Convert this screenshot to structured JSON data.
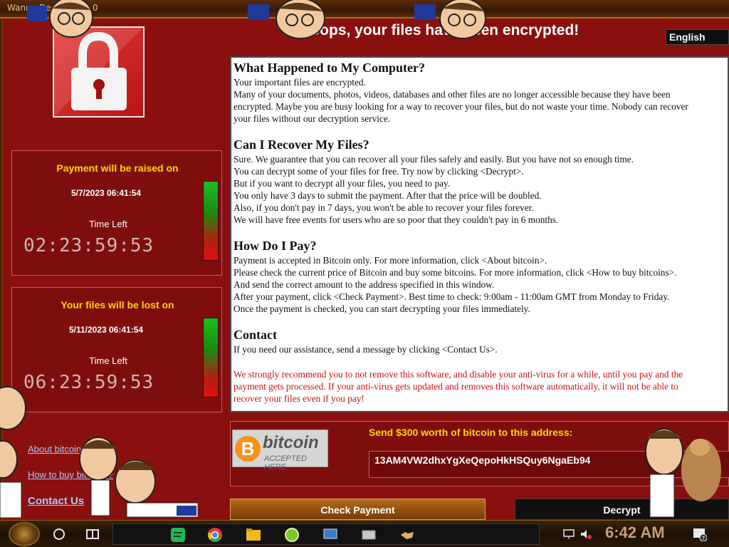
{
  "window": {
    "title": "Wanna Decryptor 2.0",
    "headline": "Ooops, your files have been encrypted!",
    "language": "English"
  },
  "timers": {
    "raise": {
      "heading": "Payment will be raised on",
      "date": "5/7/2023 06:41:54",
      "time_left_label": "Time Left",
      "countdown": "02:23:59:53"
    },
    "lost": {
      "heading": "Your files will be lost on",
      "date": "5/11/2023 06:41:54",
      "time_left_label": "Time Left",
      "countdown": "06:23:59:53"
    }
  },
  "links": {
    "about": "About bitcoin",
    "howto": "How to buy bitcoins?",
    "contact": "Contact Us"
  },
  "content": {
    "h1": "What Happened to My Computer?",
    "p1a": "Your important files are encrypted.",
    "p1b": "Many of your documents, photos, videos, databases and other files are no longer accessible because they have been",
    "p1c": "encrypted. Maybe you are busy looking for a way to recover your files, but do not waste your time. Nobody can recover",
    "p1d": "your files without our decryption service.",
    "h2": "Can I Recover My Files?",
    "p2a": "Sure. We guarantee that you can recover all your files safely and easily. But you have not so enough time.",
    "p2b": "You can decrypt some of your files for free. Try now by clicking <Decrypt>.",
    "p2c": "But if you want to decrypt all your files, you need to pay.",
    "p2d": "You only have 3 days to submit the payment. After that the price will be doubled.",
    "p2e": "Also, if you don't pay in 7 days, you won't be able to recover your files forever.",
    "p2f": "We will have free events for users who are so poor that they couldn't pay in 6 months.",
    "h3": "How Do I Pay?",
    "p3a": "Payment is accepted in Bitcoin only. For more information, click <About bitcoin>.",
    "p3b": "Please check the current price of Bitcoin and buy some bitcoins. For more information, click <How to buy bitcoins>.",
    "p3c": "And send the correct amount to the address specified in this window.",
    "p3d": "After your payment, click <Check Payment>. Best time to check: 9:00am - 11:00am GMT from Monday to Friday.",
    "p3e": "Once the payment is checked, you can start decrypting your files immediately.",
    "h4": "Contact",
    "p4a": "If you need our assistance, send a message by clicking <Contact Us>.",
    "w1": "We strongly recommend you to not remove this software, and disable your anti-virus for a while, until you pay and the",
    "w2": "payment gets processed. If your anti-virus gets updated and removes this software automatically, it will not be able to",
    "w3": "recover your files even if you pay!"
  },
  "bitcoin": {
    "symbol": "B",
    "badge_word": "bitcoin",
    "badge_sub": "ACCEPTED HERE",
    "send_label": "Send $300 worth of bitcoin to this address:",
    "address": "13AM4VW2dhxYgXeQepoHkHSQuy6NgaEb94"
  },
  "buttons": {
    "check_payment": "Check Payment",
    "decrypt": "Decrypt"
  },
  "taskbar": {
    "clock": "6:42 AM",
    "notification_count": "7",
    "apps": [
      "spreadsheet-icon",
      "chrome-icon",
      "folder-icon",
      "lime-icon",
      "monitor-icon",
      "drive-icon",
      "handshake-icon"
    ]
  },
  "colors": {
    "window_bg": "#8a1010",
    "heading_yellow": "#ffd500",
    "warning_red": "#d01010",
    "bitcoin_orange": "#f7931a"
  }
}
